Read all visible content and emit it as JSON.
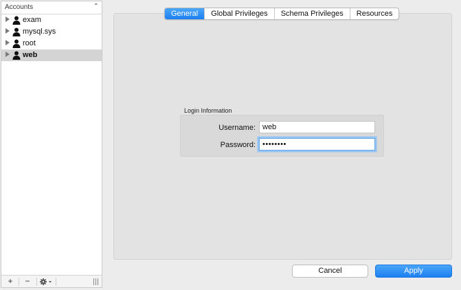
{
  "sidebar": {
    "header_title": "Accounts",
    "sort_glyph": "⌃",
    "accounts": [
      {
        "label": "exam",
        "selected": false
      },
      {
        "label": "mysql.sys",
        "selected": false
      },
      {
        "label": "root",
        "selected": false
      },
      {
        "label": "web",
        "selected": true
      }
    ],
    "footer": {
      "add_label": "+",
      "remove_label": "−",
      "gear_icon": "gear-icon"
    }
  },
  "tabs": [
    {
      "label": "General",
      "active": true
    },
    {
      "label": "Global Privileges",
      "active": false
    },
    {
      "label": "Schema Privileges",
      "active": false
    },
    {
      "label": "Resources",
      "active": false
    }
  ],
  "login": {
    "group_title": "Login Information",
    "username_label": "Username:",
    "username_value": "web",
    "password_label": "Password:",
    "password_value": "••••••••"
  },
  "buttons": {
    "cancel": "Cancel",
    "apply": "Apply"
  },
  "colors": {
    "accent": "#1c7ff1",
    "selected_row": "#d4d4d4",
    "focus_ring": "#94c2f2"
  }
}
